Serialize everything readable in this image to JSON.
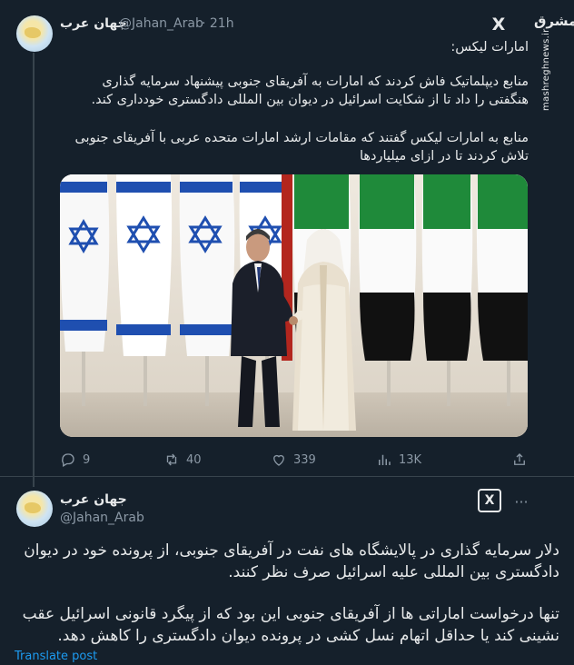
{
  "tweet": {
    "author_name": "جهان عرب",
    "handle": "@Jahan_Arab",
    "time": "· 21h",
    "title_line": "امارات لیکس:",
    "paragraph1": "منابع دیپلماتیک فاش کردند که امارات به آفریقای جنوبی پیشنهاد سرمایه گذاری هنگفتی را داد تا از شکایت اسرائیل در دیوان بین المللی دادگستری خودداری کند.",
    "paragraph2": "منابع به امارات لیکس گفتند که مقامات ارشد امارات متحده عربی با آفریقای جنوبی تلاش کردند تا در ازای میلیاردها",
    "replies": "9",
    "retweets": "40",
    "likes": "339",
    "views": "13K",
    "x_logo": "X",
    "watermark_logo": "مشرق",
    "watermark_url": "mashreghnews.ir"
  },
  "reply": {
    "author_name": "جهان عرب",
    "handle": "@Jahan_Arab",
    "paragraph1": "دلار سرمایه گذاری در پالایشگاه های نفت در آفریقای جنوبی، از پرونده خود در دیوان دادگستری بین المللی علیه اسرائیل صرف نظر کنند.",
    "paragraph2": "تنها درخواست اماراتی ها از آفریقای جنوبی این بود که از پیگرد قانونی اسرائیل عقب نشینی کند یا حداقل اتهام نسل کشی در پرونده دیوان دادگستری را کاهش دهد.",
    "x_button": "X",
    "more": "···",
    "translate": "Translate post"
  },
  "icons": {
    "reply": "reply-icon",
    "retweet": "retweet-icon",
    "like": "heart-icon",
    "views": "views-icon",
    "share": "share-icon"
  }
}
